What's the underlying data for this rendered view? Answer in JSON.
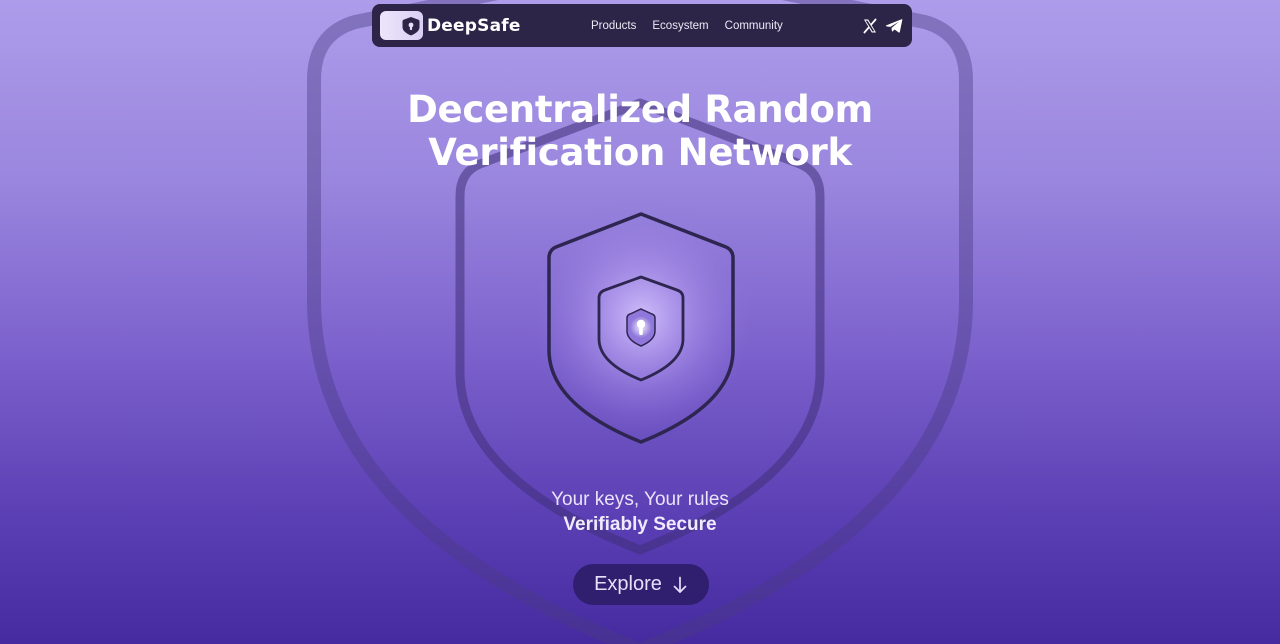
{
  "brand": {
    "name": "DeepSafe",
    "logo_icon": "keyhole-shield-icon"
  },
  "nav": {
    "links": [
      {
        "label": "Products"
      },
      {
        "label": "Ecosystem"
      },
      {
        "label": "Community"
      }
    ],
    "social": [
      {
        "icon": "x-icon"
      },
      {
        "icon": "telegram-icon"
      }
    ]
  },
  "hero": {
    "title_line1": "Decentralized Random",
    "title_line2": "Verification Network",
    "tagline_line1": "Your keys, Your rules",
    "tagline_line2": "Verifiably Secure"
  },
  "cta": {
    "explore_label": "Explore",
    "explore_icon": "arrow-down-icon"
  },
  "colors": {
    "background_top": "#ad9cea",
    "background_bottom": "#452aa0",
    "nav_background": "#2d2547",
    "button_background": "#2f1f6e",
    "text_primary": "#ffffff"
  }
}
